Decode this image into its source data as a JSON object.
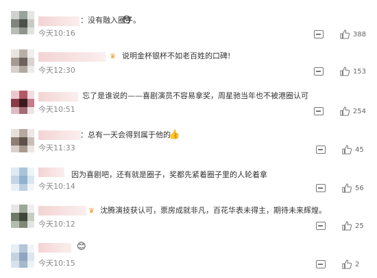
{
  "comments": [
    {
      "text": "：没有融入圈子。",
      "emoji": "😳",
      "crown": false,
      "time": "今天10:16",
      "likes": "388"
    },
    {
      "text": "说明金杯银杯不如老百姓的口碑!",
      "emoji": "",
      "crown": true,
      "time": "今天12:30",
      "likes": "153"
    },
    {
      "text": "忘了是谁说的——喜剧演员不容易拿奖，周星驰当年也不被港圈认可",
      "emoji": "",
      "crown": false,
      "time": "今天10:51",
      "likes": "254"
    },
    {
      "text": "：总有一天会得到属于他的",
      "emoji": "👍",
      "crown": false,
      "time": "今天11:33",
      "likes": "45"
    },
    {
      "text": "因为喜剧吧，还有就是圈子，奖都先紧着圈子里的人轮着拿",
      "emoji": "",
      "crown": false,
      "time": "今天10:14",
      "likes": "56"
    },
    {
      "text": "沈腾演技获认可，票房成就非凡，百花华表未得主，期待未来辉煌。",
      "emoji": "",
      "crown": true,
      "time": "今天10:12",
      "likes": "25"
    },
    {
      "text": "",
      "emoji": "😊",
      "crown": false,
      "time": "今天10:15",
      "likes": "2"
    }
  ],
  "icons": {
    "reply": "reply-icon",
    "like": "thumbs-up-icon",
    "crown": "crown-badge-icon"
  }
}
